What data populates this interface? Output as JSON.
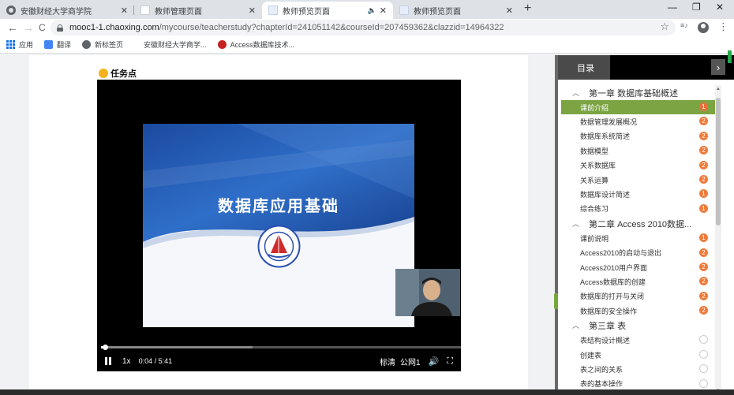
{
  "browser": {
    "tabs": [
      {
        "title": "安徽财经大学商学院",
        "icon": "globe-icon",
        "active": false
      },
      {
        "title": "教师管理页面",
        "icon": "page-icon",
        "active": false
      },
      {
        "title": "教师预览页面",
        "icon": "page-icon",
        "active": true,
        "audio": "🔈"
      },
      {
        "title": "教师预览页面",
        "icon": "page-icon",
        "active": false
      }
    ],
    "tab_close": "✕",
    "new_tab": "+",
    "window": {
      "minimize": "—",
      "restore": "❐",
      "close": "✕"
    },
    "nav": {
      "back": "←",
      "forward": "→",
      "reload": "C"
    },
    "url_host": "mooc1-1.chaoxing.com",
    "url_rest": "/mycourse/teacherstudy?chapterId=241051142&courseId=207459362&clazzid=14964322",
    "star": "☆",
    "menu": "⋮",
    "media_control": "≡♪",
    "bookmarks": [
      {
        "label": "应用",
        "icon": "apps-icon"
      },
      {
        "label": "翻译",
        "icon": "translate-icon"
      },
      {
        "label": "新标签页",
        "icon": "globe-icon"
      },
      {
        "label": "安徽财经大学商学...",
        "icon": "none"
      },
      {
        "label": "Access数据库技术...",
        "icon": "access-icon"
      }
    ]
  },
  "page": {
    "section_title": "任务点"
  },
  "player": {
    "slide_title": "数据库应用基础",
    "speed": "1x",
    "current_time": "0:04",
    "time_sep": "/",
    "duration": "5:41",
    "quality": "标清",
    "line": "公网1",
    "progress": 0.012,
    "buffered": 0.42,
    "volume_icon": "🔊",
    "fullscreen_icon": "⛶"
  },
  "toc": {
    "header": "目录",
    "collapse_glyph": "›",
    "chevron": "︿",
    "chapters": [
      {
        "title": "第一章 数据库基础概述",
        "lessons": [
          {
            "title": "课前介绍",
            "badge": "1",
            "color": "#e8713c",
            "active": true
          },
          {
            "title": "数据管理发展概况",
            "badge": "2",
            "color": "#ef7b3a"
          },
          {
            "title": "数据库系统简述",
            "badge": "2",
            "color": "#ef7b3a"
          },
          {
            "title": "数据模型",
            "badge": "2",
            "color": "#ef7b3a"
          },
          {
            "title": "关系数据库",
            "badge": "2",
            "color": "#ef7b3a"
          },
          {
            "title": "关系运算",
            "badge": "2",
            "color": "#ef7b3a"
          },
          {
            "title": "数据库设计简述",
            "badge": "1",
            "color": "#ef7b3a"
          },
          {
            "title": "综合练习",
            "badge": "1",
            "color": "#ef7b3a"
          }
        ]
      },
      {
        "title": "第二章 Access 2010数据...",
        "lessons": [
          {
            "title": "课前说明",
            "badge": "1",
            "color": "#ef7b3a"
          },
          {
            "title": "Access2010的启动与退出",
            "badge": "2",
            "color": "#ef7b3a"
          },
          {
            "title": "Access2010用户界面",
            "badge": "2",
            "color": "#ef7b3a"
          },
          {
            "title": "Access数据库的创建",
            "badge": "2",
            "color": "#ef7b3a"
          },
          {
            "title": "数据库的打开与关闭",
            "badge": "2",
            "color": "#ef7b3a"
          },
          {
            "title": "数据库的安全操作",
            "badge": "2",
            "color": "#ef7b3a"
          }
        ]
      },
      {
        "title": "第三章 表",
        "lessons": [
          {
            "title": "表结构设计概述",
            "badge": "",
            "color": ""
          },
          {
            "title": "创建表",
            "badge": "",
            "color": ""
          },
          {
            "title": "表之间的关系",
            "badge": "",
            "color": ""
          },
          {
            "title": "表的基本操作",
            "badge": "",
            "color": ""
          }
        ]
      }
    ]
  },
  "colors": {
    "accent_green": "#7ca443",
    "badge_orange": "#ef7b3a",
    "slide_blue": "#2a5fb4"
  }
}
